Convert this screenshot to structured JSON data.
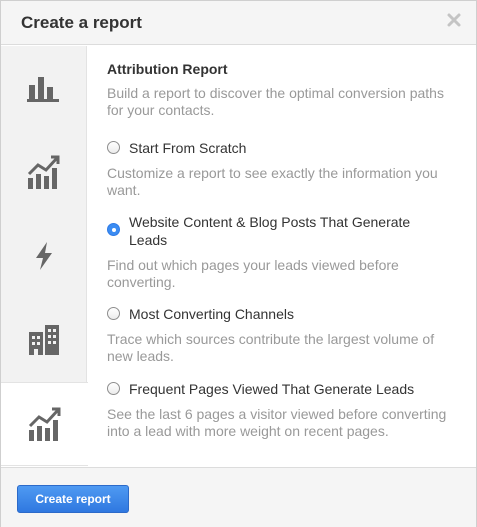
{
  "dialog": {
    "title": "Create a report"
  },
  "sidebar": {
    "items": [
      {
        "icon": "bar-chart-icon"
      },
      {
        "icon": "trend-chart-icon"
      },
      {
        "icon": "lightning-icon"
      },
      {
        "icon": "building-icon"
      },
      {
        "icon": "trend-chart-icon",
        "active": true
      }
    ]
  },
  "section": {
    "title": "Attribution Report",
    "description": "Build a report to discover the optimal conversion paths for your contacts."
  },
  "options": [
    {
      "label": "Start From Scratch",
      "description": "Customize a report to see exactly the information you want.",
      "selected": false
    },
    {
      "label": "Website Content & Blog Posts That Generate Leads",
      "description": "Find out which pages your leads viewed before converting.",
      "selected": true
    },
    {
      "label": "Most Converting Channels",
      "description": "Trace which sources contribute the largest volume of new leads.",
      "selected": false
    },
    {
      "label": "Frequent Pages Viewed That Generate Leads",
      "description": "See the last 6 pages a visitor viewed before converting into a lead with more weight on recent pages.",
      "selected": false
    }
  ],
  "footer": {
    "create_label": "Create report"
  },
  "colors": {
    "accent": "#3b8cf2",
    "icon": "#666666"
  }
}
